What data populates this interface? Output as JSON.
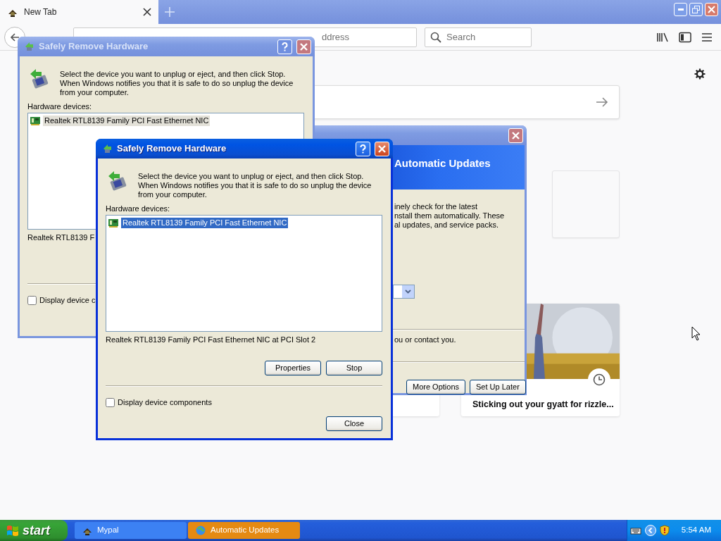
{
  "browser": {
    "tabs": [
      {
        "label": "New Tab",
        "selected": true
      }
    ],
    "address": {
      "placeholder": "ddress"
    },
    "search": {
      "placeholder": "Search"
    }
  },
  "new_tab_page": {
    "story": {
      "title": "Sticking out your gyatt for rizzle..."
    }
  },
  "dialogs": [
    {
      "title": "Safely Remove Hardware",
      "active": false,
      "instructions": "Select the device you want to unplug or eject, and then click Stop. When Windows notifies you that it is safe to do so unplug the device from your computer.",
      "list_label": "Hardware devices:",
      "devices": [
        {
          "name": "Realtek RTL8139 Family PCI Fast Ethernet NIC",
          "selected": true
        }
      ],
      "device_detail": "Realtek RTL8139 F",
      "checkbox": {
        "label": "Display device c",
        "checked": false
      }
    },
    {
      "title": "Safely Remove Hardware",
      "active": true,
      "instructions": "Select the device you want to unplug or eject, and then click Stop. When Windows notifies you that it is safe to do so unplug the device from your computer.",
      "list_label": "Hardware devices:",
      "devices": [
        {
          "name": "Realtek RTL8139 Family PCI Fast Ethernet NIC",
          "selected": true
        }
      ],
      "device_detail": "Realtek RTL8139 Family PCI Fast Ethernet NIC at PCI Slot 2",
      "checkbox": {
        "label": "Display device components",
        "checked": false
      },
      "buttons": [
        "Properties",
        "Stop"
      ],
      "close_button": "Close"
    }
  ],
  "updates_dialog": {
    "header": "Automatic Updates",
    "text_lines": [
      "inely check for the latest",
      "nstall them automatically. These",
      "al updates, and service packs."
    ],
    "note": "ou or contact you.",
    "buttons": [
      "More Options",
      "Set Up Later"
    ]
  },
  "taskbar": {
    "start": "start",
    "tasks": [
      {
        "label": "Mypal",
        "flashing": false
      },
      {
        "label": "Automatic Updates",
        "flashing": true
      }
    ],
    "clock": "5:54 AM"
  }
}
